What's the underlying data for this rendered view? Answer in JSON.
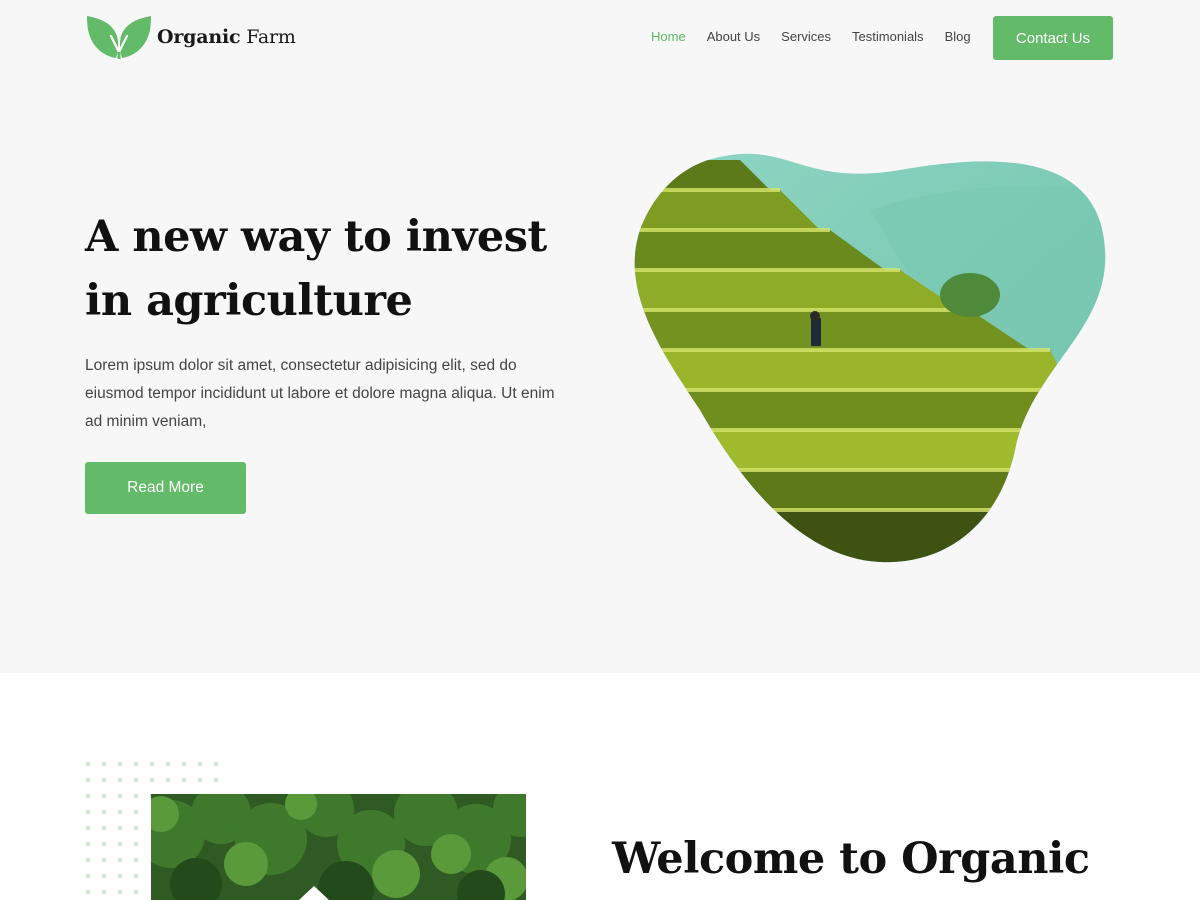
{
  "brand": {
    "name_bold": "Organic",
    "name_rest": " Farm",
    "accent_color": "#63bb6a"
  },
  "nav": {
    "items": [
      {
        "label": "Home",
        "active": true
      },
      {
        "label": "About Us",
        "active": false
      },
      {
        "label": "Services",
        "active": false
      },
      {
        "label": "Testimonials",
        "active": false
      },
      {
        "label": "Blog",
        "active": false
      }
    ],
    "contact_label": "Contact Us"
  },
  "hero": {
    "title": "A new way to invest in agriculture",
    "text": "Lorem ipsum dolor sit amet, consectetur adipisicing elit, sed do eiusmod tempor incididunt ut labore et dolore magna aliqua. Ut enim ad minim veniam,",
    "button_label": "Read More",
    "image_icon": "rice-terraces-image"
  },
  "welcome": {
    "title": "Welcome to Organic",
    "image_icon": "forest-image"
  }
}
